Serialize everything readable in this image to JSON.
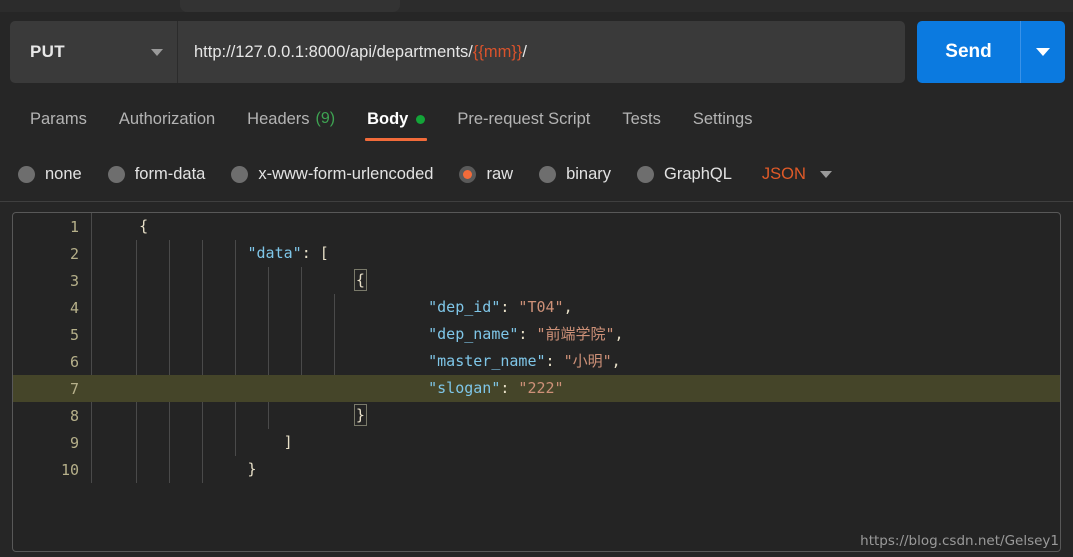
{
  "window": {
    "tab_strip_visible": true
  },
  "request_bar": {
    "method": "PUT",
    "url_prefix": "http://127.0.0.1:8000/api/departments/",
    "url_variable": "{{mm}}",
    "url_suffix": "/",
    "send_label": "Send"
  },
  "tabs": [
    {
      "label": "Params",
      "active": false,
      "count": "",
      "dot": false
    },
    {
      "label": "Authorization",
      "active": false,
      "count": "",
      "dot": false
    },
    {
      "label": "Headers",
      "active": false,
      "count": "(9)",
      "dot": false
    },
    {
      "label": "Body",
      "active": true,
      "count": "",
      "dot": true
    },
    {
      "label": "Pre-request Script",
      "active": false,
      "count": "",
      "dot": false
    },
    {
      "label": "Tests",
      "active": false,
      "count": "",
      "dot": false
    },
    {
      "label": "Settings",
      "active": false,
      "count": "",
      "dot": false
    }
  ],
  "body_types": [
    {
      "label": "none",
      "checked": false
    },
    {
      "label": "form-data",
      "checked": false
    },
    {
      "label": "x-www-form-urlencoded",
      "checked": false
    },
    {
      "label": "raw",
      "checked": true
    },
    {
      "label": "binary",
      "checked": false
    },
    {
      "label": "GraphQL",
      "checked": false
    }
  ],
  "format_selector": {
    "label": "JSON"
  },
  "editor": {
    "line_numbers": [
      "1",
      "2",
      "3",
      "4",
      "5",
      "6",
      "7",
      "8",
      "9",
      "10"
    ],
    "highlighted_line": 7,
    "lines": [
      {
        "num": "1",
        "indent": 1,
        "text": "{"
      },
      {
        "num": "2",
        "indent": 4,
        "key": "\"data\"",
        "sep": ": ",
        "text": "["
      },
      {
        "num": "3",
        "indent": 7,
        "text": "{",
        "bracket_match": true
      },
      {
        "num": "4",
        "indent": 9,
        "key": "\"dep_id\"",
        "sep": ": ",
        "value": "\"T04\"",
        "tail": ","
      },
      {
        "num": "5",
        "indent": 9,
        "key": "\"dep_name\"",
        "sep": ": ",
        "value": "\"前端学院\"",
        "tail": ","
      },
      {
        "num": "6",
        "indent": 9,
        "key": "\"master_name\"",
        "sep": ": ",
        "value": "\"小明\"",
        "tail": ","
      },
      {
        "num": "7",
        "indent": 9,
        "key": "\"slogan\"",
        "sep": ": ",
        "value": "\"222\"",
        "tail": ""
      },
      {
        "num": "8",
        "indent": 7,
        "text": "}",
        "bracket_match": true
      },
      {
        "num": "9",
        "indent": 5,
        "text": "]"
      },
      {
        "num": "10",
        "indent": 4,
        "text": "}"
      }
    ],
    "raw_text": "{\n    \"data\": [\n        {\n            \"dep_id\": \"T04\",\n            \"dep_name\": \"前端学院\",\n            \"master_name\": \"小明\",\n            \"slogan\": \"222\"\n        }\n    ]\n}"
  },
  "watermark": {
    "text": "https://blog.csdn.net/Gelsey1"
  },
  "colors": {
    "accent_orange": "#f26b3a",
    "send_blue": "#0b7ae0",
    "green": "#13a438",
    "json_label": "#e05a28",
    "variable": "#d9532c",
    "key": "#7fc6e8",
    "string": "#ce9178",
    "highlight_line": "#454529"
  }
}
